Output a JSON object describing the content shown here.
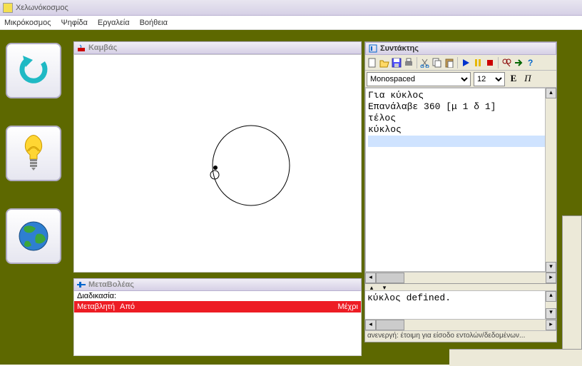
{
  "window": {
    "title": "Χελωνόκοσμος"
  },
  "menu": {
    "m1": "Μικρόκοσμος",
    "m2": "Ψηφίδα",
    "m3": "Εργαλεία",
    "m4": "Βοήθεια"
  },
  "canvas": {
    "title": "Καμβάς"
  },
  "vars": {
    "title": "ΜεταΒολέας",
    "proc_label": "Διαδικασία:",
    "col_var": "Μεταβλητή",
    "col_from": "Από",
    "col_to": "Μέχρι"
  },
  "editor": {
    "title": "Συντάκτης",
    "font": "Monospaced",
    "size": "12",
    "bold": "E",
    "italic": "Π",
    "code": {
      "l1": "Για κύκλος",
      "l2": "Επανάλαβε 360 [μ 1 δ 1]",
      "l3": "τέλος",
      "l4": "κύκλος"
    },
    "output": "κύκλος defined.",
    "status": "ανενεργή: έτοιμη για είσοδο εντολών/δεδομένων..."
  },
  "icons": {
    "new": "new-icon",
    "open": "open-icon",
    "save": "save-icon",
    "print": "print-icon",
    "cut": "cut-icon",
    "copy": "copy-icon",
    "paste": "paste-icon",
    "play": "play-icon",
    "pause": "pause-icon",
    "stop": "stop-icon",
    "find": "find-icon",
    "goto": "goto-icon",
    "help": "help-icon"
  }
}
